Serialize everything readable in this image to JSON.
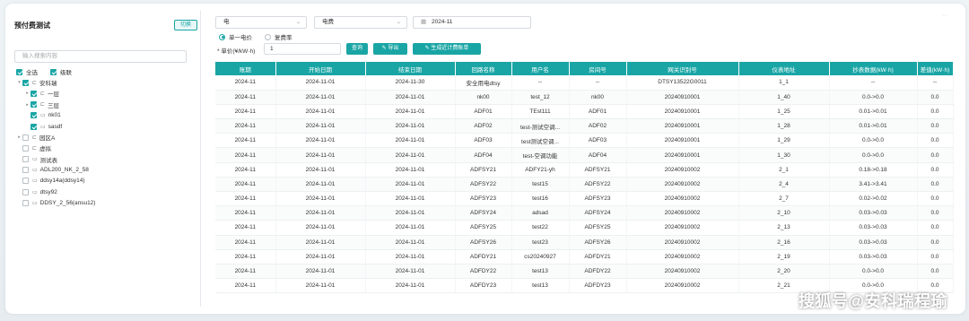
{
  "sidebar": {
    "title": "预付费测试",
    "action_label": "切换",
    "search_placeholder": "输入搜索内容",
    "select_all": "全选",
    "linkage": "级联",
    "tree": [
      {
        "label": "安科瑞",
        "level": 1,
        "arrow": "▾",
        "checked": true,
        "icon": "folder"
      },
      {
        "label": "一层",
        "level": 2,
        "arrow": "▸",
        "checked": true,
        "icon": "folder"
      },
      {
        "label": "三层",
        "level": 2,
        "arrow": "▸",
        "checked": true,
        "icon": "folder"
      },
      {
        "label": "nk01",
        "level": 2,
        "arrow": "",
        "checked": true,
        "icon": "meter"
      },
      {
        "label": "sasdf",
        "level": 2,
        "arrow": "",
        "checked": true,
        "icon": "meter"
      },
      {
        "label": "园区A",
        "level": 1,
        "arrow": "▸",
        "checked": false,
        "icon": "folder"
      },
      {
        "label": "虚拟",
        "level": 1,
        "arrow": "",
        "checked": false,
        "icon": "folder"
      },
      {
        "label": "测试表",
        "level": 1,
        "arrow": "",
        "checked": false,
        "icon": "meter"
      },
      {
        "label": "ADL200_NK_2_58",
        "level": 1,
        "arrow": "",
        "checked": false,
        "icon": "meter"
      },
      {
        "label": "ddsy14a(ddsy14)",
        "level": 1,
        "arrow": "",
        "checked": false,
        "icon": "meter"
      },
      {
        "label": "dtsy92",
        "level": 1,
        "arrow": "",
        "checked": false,
        "icon": "meter"
      },
      {
        "label": "DDSY_2_56(ansu12)",
        "level": 1,
        "arrow": "",
        "checked": false,
        "icon": "meter"
      }
    ]
  },
  "filters": {
    "energy_type": "电",
    "fee_type": "电费",
    "month": "2024-11",
    "radio_single": "单一电价",
    "radio_multi": "复费率",
    "price_label": "* 单价(¥/kW·h)",
    "price_value": "1",
    "query_label": "查询",
    "export_label": "导出",
    "generate_label": "生成近计费账单"
  },
  "table": {
    "headers": [
      "账期",
      "开始日期",
      "结束日期",
      "回路名称",
      "用户名",
      "房间号",
      "网关识别号",
      "仪表地址",
      "抄表数据(kW·h)",
      "差值(kW·h)"
    ],
    "rows": [
      [
        "2024-11",
        "2024-11-01",
        "2024-11-30",
        "安全用电dtsy",
        "--",
        "--",
        "DTSY13522G0011",
        "1_1",
        "--",
        "--"
      ],
      [
        "2024-11",
        "2024-11-01",
        "2024-11-01",
        "nk00",
        "test_12",
        "nk00",
        "20240910001",
        "1_40",
        "0.0->0.0",
        "0.0"
      ],
      [
        "2024-11",
        "2024-11-01",
        "2024-11-01",
        "ADF01",
        "TEst111",
        "ADF01",
        "20240910001",
        "1_25",
        "0.01->0.01",
        "0.0"
      ],
      [
        "2024-11",
        "2024-11-01",
        "2024-11-01",
        "ADF02",
        "test-测试空调...",
        "ADF02",
        "20240910001",
        "1_28",
        "0.01->0.01",
        "0.0"
      ],
      [
        "2024-11",
        "2024-11-01",
        "2024-11-01",
        "ADF03",
        "test测试空调...",
        "ADF03",
        "20240910001",
        "1_29",
        "0.0->0.0",
        "0.0"
      ],
      [
        "2024-11",
        "2024-11-01",
        "2024-11-01",
        "ADF04",
        "test-空调功能",
        "ADF04",
        "20240910001",
        "1_30",
        "0.0->0.0",
        "0.0"
      ],
      [
        "2024-11",
        "2024-11-01",
        "2024-11-01",
        "ADFSY21",
        "ADFY21-yh",
        "ADFSY21",
        "20240910002",
        "2_1",
        "0.18->0.18",
        "0.0"
      ],
      [
        "2024-11",
        "2024-11-01",
        "2024-11-01",
        "ADFSY22",
        "test15",
        "ADFSY22",
        "20240910002",
        "2_4",
        "3.41->3.41",
        "0.0"
      ],
      [
        "2024-11",
        "2024-11-01",
        "2024-11-01",
        "ADFSY23",
        "test16",
        "ADFSY23",
        "20240910002",
        "2_7",
        "0.02->0.02",
        "0.0"
      ],
      [
        "2024-11",
        "2024-11-01",
        "2024-11-01",
        "ADFSY24",
        "adsad",
        "ADFSY24",
        "20240910002",
        "2_10",
        "0.03->0.03",
        "0.0"
      ],
      [
        "2024-11",
        "2024-11-01",
        "2024-11-01",
        "ADFSY25",
        "test22",
        "ADFSY25",
        "20240910002",
        "2_13",
        "0.03->0.03",
        "0.0"
      ],
      [
        "2024-11",
        "2024-11-01",
        "2024-11-01",
        "ADFSY26",
        "test23",
        "ADFSY26",
        "20240910002",
        "2_16",
        "0.03->0.03",
        "0.0"
      ],
      [
        "2024-11",
        "2024-11-01",
        "2024-11-01",
        "ADFDY21",
        "cs20240927",
        "ADFDY21",
        "20240910002",
        "2_19",
        "0.03->0.03",
        "0.0"
      ],
      [
        "2024-11",
        "2024-11-01",
        "2024-11-01",
        "ADFDY22",
        "test13",
        "ADFDY22",
        "20240910002",
        "2_20",
        "0.0->0.0",
        "0.0"
      ],
      [
        "2024-11",
        "2024-11-01",
        "2024-11-01",
        "ADFDY23",
        "test13",
        "ADFDY23",
        "20240910002",
        "2_21",
        "0.0->0.0",
        "0.0"
      ]
    ]
  },
  "watermark": "搜狐号@安科瑞程瑜",
  "colors": {
    "accent": "#1aa5a5",
    "header_bg": "#1aa5a5"
  }
}
